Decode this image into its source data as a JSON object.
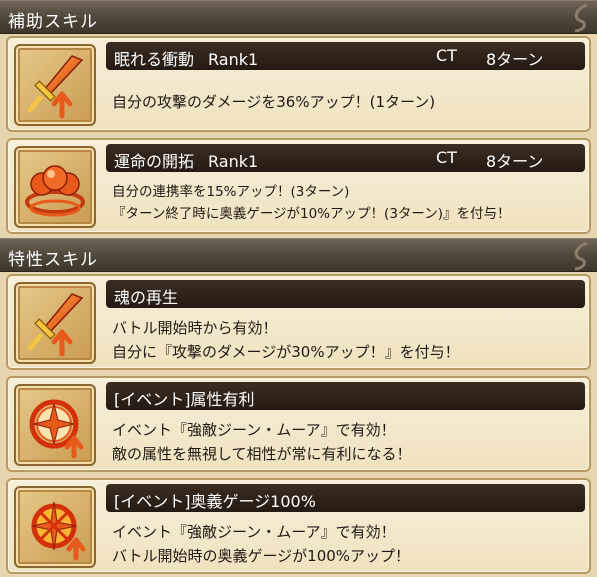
{
  "sections": [
    {
      "title": "補助スキル"
    },
    {
      "title": "特性スキル"
    }
  ],
  "cards": [
    {
      "name": "眠れる衝動",
      "rank": "Rank1",
      "ct_label": "CT",
      "ct_value": "8ターン",
      "icon": "sword-up-icon",
      "lines": [
        "自分の攻撃のダメージを36%アップ！(1ターン)"
      ]
    },
    {
      "name": "運命の開拓",
      "rank": "Rank1",
      "ct_label": "CT",
      "ct_value": "8ターン",
      "icon": "chain-balls-icon",
      "lines": [
        "自分の連携率を15%アップ！(3ターン)",
        "『ターン終了時に奥義ゲージが10%アップ！(3ターン)』を付与！"
      ]
    },
    {
      "name": "魂の再生",
      "icon": "sword-up-icon",
      "lines": [
        "バトル開始時から有効！",
        "自分に『攻撃のダメージが30%アップ！』を付与！"
      ]
    },
    {
      "name": "[イベント]属性有利",
      "icon": "element-star-icon",
      "lines": [
        "イベント『強敵ジーン・ムーア』で有効！",
        "敵の属性を無視して相性が常に有利になる！"
      ]
    },
    {
      "name": "[イベント]奥義ゲージ100%",
      "icon": "burst-gauge-icon",
      "lines": [
        "イベント『強敵ジーン・ムーア』で有効！",
        "バトル開始時の奥義ゲージが100%アップ！"
      ]
    }
  ],
  "colors": {
    "header_bg": "#4e4539",
    "card_bg": "#f7efd9",
    "name_bar_bg": "#2b2018",
    "icon_orange": "#e8591c"
  }
}
